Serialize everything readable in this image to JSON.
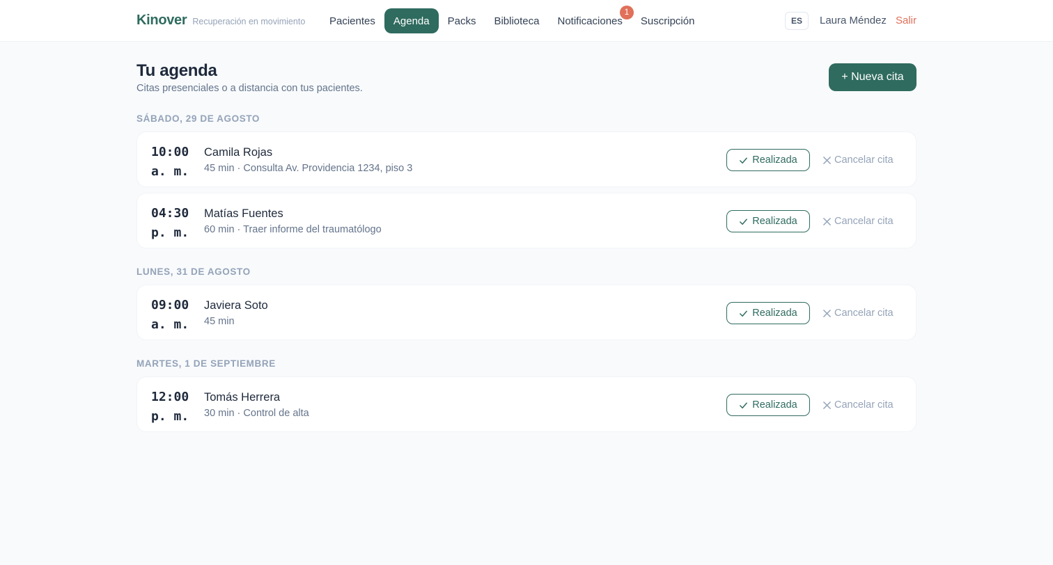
{
  "brand": {
    "name": "Kinover",
    "tagline": "Recuperación en movimiento"
  },
  "nav": {
    "items": [
      {
        "label": "Pacientes",
        "active": false
      },
      {
        "label": "Agenda",
        "active": true
      },
      {
        "label": "Packs",
        "active": false
      },
      {
        "label": "Biblioteca",
        "active": false
      },
      {
        "label": "Notificaciones",
        "active": false,
        "badge": "1"
      },
      {
        "label": "Suscripción",
        "active": false
      }
    ]
  },
  "header": {
    "language": "ES",
    "user": "Laura Méndez",
    "logout": "Salir"
  },
  "page": {
    "title": "Tu agenda",
    "subtitle": "Citas presenciales o a distancia con tus pacientes.",
    "new_button": "+ Nueva cita"
  },
  "actions": {
    "done_label": "Realizada",
    "cancel_label": "Cancelar cita"
  },
  "days": [
    {
      "label": "Sábado, 29 de agosto",
      "appointments": [
        {
          "time": "10:00",
          "period": "a. m.",
          "patient": "Camila Rojas",
          "detail": "45 min · Consulta Av. Providencia 1234, piso 3"
        },
        {
          "time": "04:30",
          "period": "p. m.",
          "patient": "Matías Fuentes",
          "detail": "60 min · Traer informe del traumatólogo"
        }
      ]
    },
    {
      "label": "Lunes, 31 de agosto",
      "appointments": [
        {
          "time": "09:00",
          "period": "a. m.",
          "patient": "Javiera Soto",
          "detail": "45 min"
        }
      ]
    },
    {
      "label": "Martes, 1 de septiembre",
      "appointments": [
        {
          "time": "12:00",
          "period": "p. m.",
          "patient": "Tomás Herrera",
          "detail": "30 min · Control de alta"
        }
      ]
    }
  ],
  "colors": {
    "brand": "#2f6b5f",
    "accent": "#e0705a",
    "muted": "#94a3b8"
  }
}
